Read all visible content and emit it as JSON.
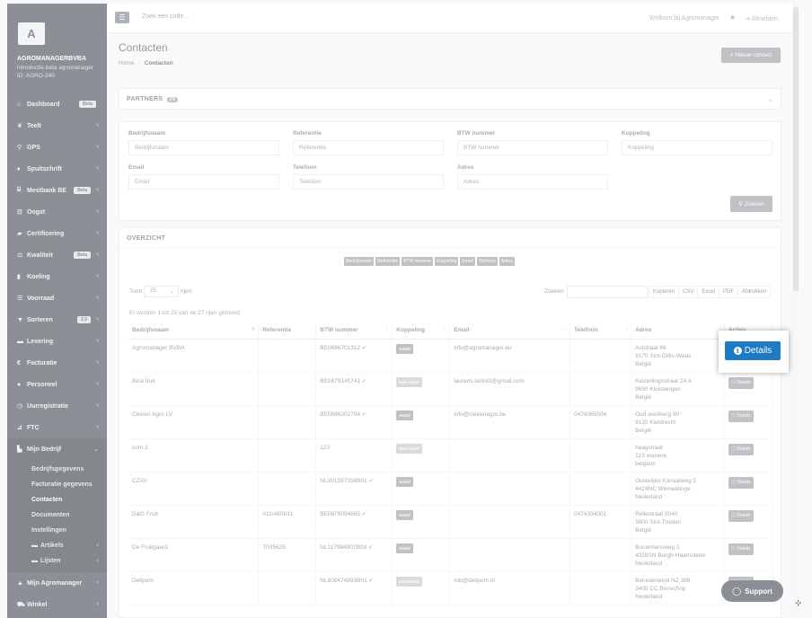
{
  "sidebar": {
    "logo_letter": "A",
    "company": "AGROMANAGERBVBA",
    "intro": "introductie beta agromanager",
    "org_id": "ID: AGRO-340",
    "items": [
      {
        "label": "Dashboard",
        "icon": "home-icon",
        "glyph": "⌂",
        "badge": "Beta",
        "chev": false
      },
      {
        "label": "Teelt",
        "icon": "leaf-icon",
        "glyph": "❦",
        "badge": "",
        "chev": true
      },
      {
        "label": "GPS",
        "icon": "map-marker-icon",
        "glyph": "⚲",
        "badge": "",
        "chev": true
      },
      {
        "label": "Spuitschrift",
        "icon": "drop-icon",
        "glyph": "♦",
        "badge": "",
        "chev": true
      },
      {
        "label": "Mestbank BE",
        "icon": "bank-icon",
        "glyph": "⌸",
        "badge": "Beta",
        "chev": true
      },
      {
        "label": "Oogst",
        "icon": "basket-icon",
        "glyph": "⊟",
        "badge": "",
        "chev": true
      },
      {
        "label": "Certificering",
        "icon": "certificate-icon",
        "glyph": "▰",
        "badge": "",
        "chev": true
      },
      {
        "label": "Kwaliteit",
        "icon": "scale-icon",
        "glyph": "⚖",
        "badge": "Beta",
        "chev": true
      },
      {
        "label": "Koeling",
        "icon": "thermometer-icon",
        "glyph": "▮",
        "badge": "",
        "chev": true
      },
      {
        "label": "Voorraad",
        "icon": "list-icon",
        "glyph": "☰",
        "badge": "",
        "chev": true
      },
      {
        "label": "Sorteren",
        "icon": "filter-icon",
        "glyph": "▼",
        "badge": "2.0",
        "chev": true
      },
      {
        "label": "Levering",
        "icon": "truck-icon",
        "glyph": "▬",
        "badge": "",
        "chev": true
      },
      {
        "label": "Facturatie",
        "icon": "euro-icon",
        "glyph": "€",
        "badge": "",
        "chev": true
      },
      {
        "label": "Personeel",
        "icon": "user-icon",
        "glyph": "●",
        "badge": "",
        "chev": true
      },
      {
        "label": "Uurregistratie",
        "icon": "clock-icon",
        "glyph": "◷",
        "badge": "",
        "chev": true
      },
      {
        "label": "FTC",
        "icon": "chart-icon",
        "glyph": "⊿",
        "badge": "",
        "chev": true
      }
    ],
    "active_item": {
      "label": "Mijn Bedrijf",
      "icon": "building-icon",
      "glyph": "▙"
    },
    "sub_items": [
      {
        "label": "Bedrijfsgegevens",
        "folder": false,
        "current": false
      },
      {
        "label": "Facturatie gegevens",
        "folder": false,
        "current": false
      },
      {
        "label": "Contacten",
        "folder": false,
        "current": true
      },
      {
        "label": "Documenten",
        "folder": false,
        "current": false
      },
      {
        "label": "Instellingen",
        "folder": false,
        "current": false
      },
      {
        "label": "Artikels",
        "folder": true,
        "current": false
      },
      {
        "label": "Lijsten",
        "folder": true,
        "current": false
      }
    ],
    "bottom_items": [
      {
        "label": "Mijn Agromanager",
        "icon": "car-icon",
        "glyph": "▲"
      },
      {
        "label": "Winkel",
        "icon": "cart-icon",
        "glyph": "⛟"
      }
    ]
  },
  "topbar": {
    "search_placeholder": "Zoek een code...",
    "welcome": "Welkom bij Agromanager",
    "logout": "Afmelden"
  },
  "page": {
    "title": "Contacten",
    "crumb_home": "Home",
    "crumb_sep": "/",
    "crumb_current": "Contacten",
    "new_contact": "+ Nieuw contact"
  },
  "partners": {
    "title": "PARTNERS",
    "count": "29"
  },
  "filters": {
    "fields": [
      {
        "label": "Bedrijfsnaam",
        "placeholder": "Bedrijfsnaam"
      },
      {
        "label": "Referentie",
        "placeholder": "Referentie"
      },
      {
        "label": "BTW nummer",
        "placeholder": "BTW nummer"
      },
      {
        "label": "Koppeling",
        "placeholder": "Koppeling"
      },
      {
        "label": "Email",
        "placeholder": "Email"
      },
      {
        "label": "Telefoon",
        "placeholder": "Telefoon"
      },
      {
        "label": "Adres",
        "placeholder": "Adres"
      }
    ],
    "search_button": "Zoeken"
  },
  "overview": {
    "title": "OVERZICHT",
    "column_toggles": [
      "Bedrijfsnaam",
      "Referentie",
      "BTW nummer",
      "Koppeling",
      "Email",
      "Telefoon",
      "Adres"
    ],
    "show_label": "Toon",
    "page_size": "25",
    "rows_label": "rijen",
    "search_label": "Zoeken",
    "export_buttons": [
      "Kopieren",
      "CSV",
      "Excel",
      "PDF",
      "Afdrukken"
    ],
    "info": "Er worden 1 tot 25 van de 27 rijen getoond",
    "columns": [
      "Bedrijfsnaam",
      "Referentie",
      "BTW nummer",
      "Koppeling",
      "Email",
      "Telefoon",
      "Adres",
      "Acties"
    ],
    "details_label": "Details",
    "rows": [
      {
        "name": "Agromanager BVBA",
        "ref": "",
        "btw": "BE0696701312",
        "verified": true,
        "link": "Actief",
        "email": "info@agromanager.eu",
        "phone": "",
        "address": [
          "Aststraat 66",
          "9170 Sint-Gillis-Waas",
          "België"
        ]
      },
      {
        "name": "Best fruit",
        "ref": "",
        "btw": "BE0879145741",
        "verified": true,
        "link": "Niet-Actief",
        "email": "laurens.tack93@gmail.com",
        "phone": "",
        "address": [
          "Keizerlingsstraat 24 A",
          "9690 Kluisbergen",
          "België"
        ]
      },
      {
        "name": "Cleiren Agro LV",
        "ref": "",
        "btw": "BE0896202794",
        "verified": true,
        "link": "Actief",
        "email": "info@cleirenagro.be",
        "phone": "0478365504",
        "address": [
          "Oud arenberg 90",
          "9130 Kieldrecht",
          "België"
        ]
      },
      {
        "name": "com 2",
        "ref": "",
        "btw": "123",
        "verified": false,
        "link": "Niet-Actief",
        "email": "",
        "phone": "",
        "address": [
          "haagstraat",
          "123 wasene",
          "belgium"
        ]
      },
      {
        "name": "CZAV",
        "ref": "",
        "btw": "NL001597358B01",
        "verified": true,
        "link": "Actief",
        "email": "",
        "phone": "",
        "address": [
          "Oostelijke Kanaalweg 5",
          "4424NC Wemeldinge",
          "Nederland"
        ]
      },
      {
        "name": "D&G Fruit",
        "ref": "011/480631",
        "btw": "BE0879094865",
        "verified": true,
        "link": "Actief",
        "email": "",
        "phone": "0474334001",
        "address": [
          "Rellestraat 5040",
          "3800 Sint-Truiden",
          "België"
        ]
      },
      {
        "name": "De Fruitgaard",
        "ref": "T035625",
        "btw": "NL117984802B03",
        "verified": true,
        "link": "Actief",
        "email": "",
        "phone": "",
        "address": [
          "Bouwmansweg 1",
          "4328SN Burgh-Haamstede",
          "Nederland"
        ]
      },
      {
        "name": "Delipom",
        "ref": "",
        "btw": "NL808474893B01",
        "verified": true,
        "link": "Niet-Actief",
        "email": "rob@delipom.nl",
        "phone": "",
        "address": [
          "Benedeneind NZ 388",
          "3405 CC Benschop",
          "Nederland"
        ]
      }
    ]
  },
  "popup": {
    "label": "Details"
  },
  "support": {
    "label": "Support"
  },
  "colors": {
    "sidebar": "#2f3640",
    "primary": "#1e7bc3",
    "button": "#8a8f96"
  }
}
